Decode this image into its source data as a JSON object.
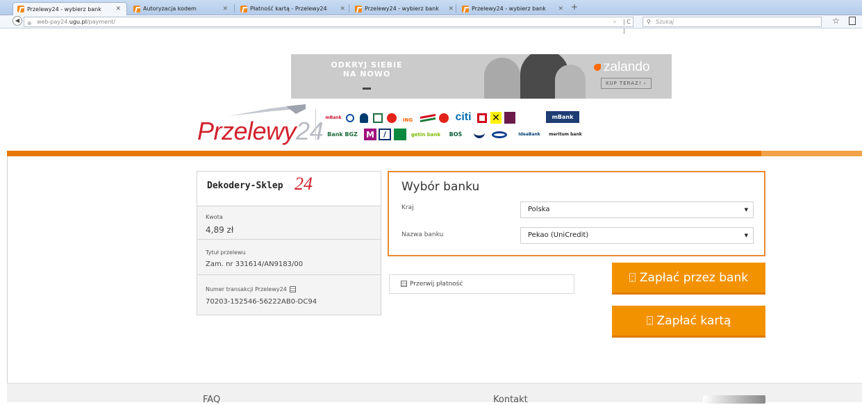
{
  "browser": {
    "tabs": [
      {
        "title": "Przelewy24 - wybierz bank",
        "active": true
      },
      {
        "title": "Autoryzacja kodem",
        "active": false
      },
      {
        "title": "Płatność kartą - Przelewy24",
        "active": false
      },
      {
        "title": "Przelewy24 - wybierz bank",
        "active": false
      },
      {
        "title": "Przelewy24 - wybierz bank",
        "active": false
      }
    ],
    "new_tab": "+",
    "url_prefix": "web-pay24.",
    "url_domain": "ugu.pl",
    "url_path": "/payment/",
    "search_placeholder": "Szukaj"
  },
  "banner": {
    "tagline": "ODKRYJ SIEBIE NA NOWO",
    "brand": "zalando",
    "cta": "KUP TERAZ! ›"
  },
  "logo": {
    "text": "Przelewy",
    "number": "24"
  },
  "banks_row1": [
    {
      "name": "mBank",
      "color": "#c8102e"
    },
    {
      "name": "",
      "color": "#0a4da2"
    },
    {
      "name": "",
      "color": "#003b70"
    },
    {
      "name": "",
      "color": "#1b6d3d"
    },
    {
      "name": "",
      "color": "#e2231a"
    },
    {
      "name": "ING",
      "color": "#ff6200"
    },
    {
      "name": "",
      "color": "#d0021b"
    },
    {
      "name": "",
      "color": "#e2231a"
    },
    {
      "name": "citi",
      "color": "#056dae"
    },
    {
      "name": "",
      "color": "#d0021b"
    },
    {
      "name": "",
      "color": "#111111"
    },
    {
      "name": "",
      "color": "#6b1a4a"
    },
    {
      "name": "mBank",
      "color": "#1d3d73"
    }
  ],
  "banks_row2": [
    {
      "name": "Bank BGZ",
      "color": "#1c6b3a"
    },
    {
      "name": "",
      "color": "#a1127e"
    },
    {
      "name": "",
      "color": "#0a2f6b"
    },
    {
      "name": "",
      "color": "#0a8a3f"
    },
    {
      "name": "getin bank",
      "color": "#7cba00"
    },
    {
      "name": "BOŚ",
      "color": "#0a5c38"
    },
    {
      "name": "",
      "color": "#0a2f6b"
    },
    {
      "name": "",
      "color": "#0a3d8f"
    },
    {
      "name": "IdeaBank",
      "color": "#003b70"
    },
    {
      "name": "meritum bank",
      "color": "#1a1a1a"
    }
  ],
  "summary": {
    "shop_name": "Dekodery-Sklep",
    "shop_number": "24",
    "amount_label": "Kwota",
    "amount_value": "4,89 zł",
    "title_label": "Tytuł przelewu",
    "title_value": "Zam. nr 331614/AN9183/00",
    "txn_label": "Numer transakcji Przelewy24",
    "txn_value": "70203-152546-56222AB0-DC94"
  },
  "bank_selection": {
    "title": "Wybór banku",
    "country_label": "Kraj",
    "country_value": "Polska",
    "bank_label": "Nazwa banku",
    "bank_value": "Pekao (UniCredit)"
  },
  "actions": {
    "cancel_label": "Przerwij płatność",
    "pay_bank_label": "Zapłać przez bank",
    "pay_card_label": "Zapłać kartą"
  },
  "footer": {
    "faq": "FAQ",
    "contact": "Kontakt"
  },
  "colors": {
    "accent_orange": "#f39200",
    "brand_red": "#d2212e"
  }
}
